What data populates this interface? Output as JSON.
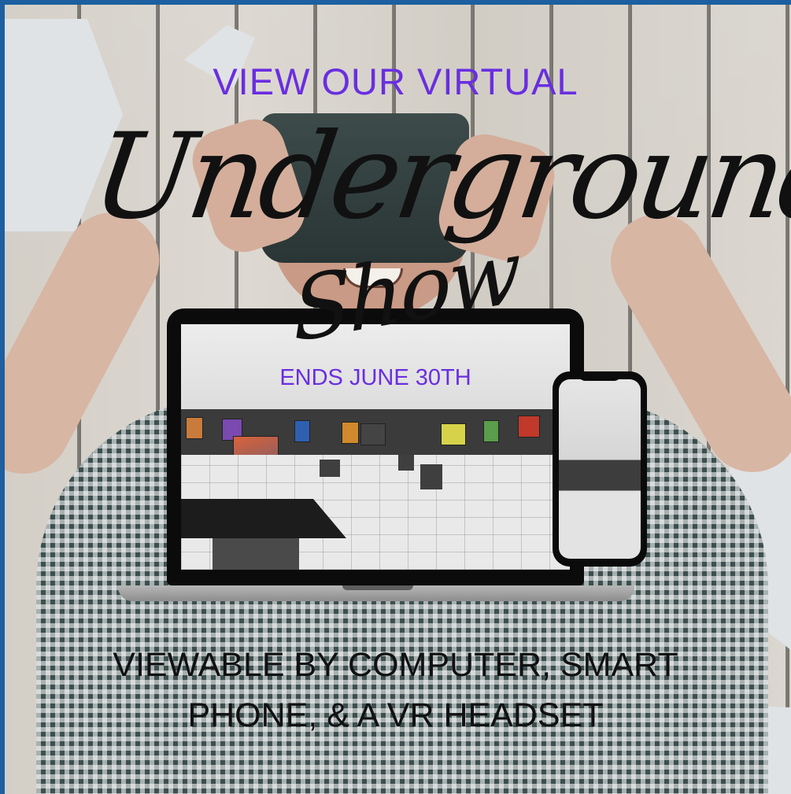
{
  "poster": {
    "headline": "VIEW OUR VIRTUAL",
    "script_title_line1": "Underground Art",
    "script_title_line2": "Show",
    "end_date": "ENDS JUNE 30TH",
    "devices_line1": "VIEWABLE BY COMPUTER, SMART",
    "devices_line2": "PHONE, & A VR HEADSET"
  },
  "colors": {
    "frame": "#1d5fa0",
    "accent_purple": "#6a2ee0",
    "text_dark": "#111111"
  },
  "icons": [
    "laptop-device",
    "smartphone-device",
    "vr-headset"
  ]
}
